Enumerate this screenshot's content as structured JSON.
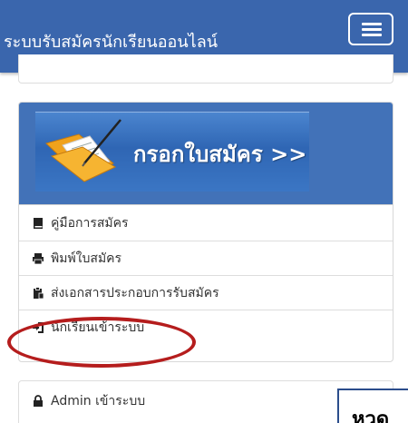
{
  "navbar": {
    "title": "ระบบรับสมัครนักเรียนออนไลน์"
  },
  "banner": {
    "text": "กรอกใบสมัคร >>"
  },
  "menu": {
    "items": [
      {
        "label": "คู่มือการสมัคร",
        "icon": "book-icon"
      },
      {
        "label": "พิมพ์ใบสมัคร",
        "icon": "print-icon"
      },
      {
        "label": "ส่งเอกสารประกอบการรับสมัคร",
        "icon": "clipboard-icon"
      },
      {
        "label": "นักเรียนเข้าระบบ",
        "icon": "sign-in-icon"
      }
    ]
  },
  "admin": {
    "label": "Admin เข้าระบบ",
    "icon": "lock-icon"
  },
  "overlay": {
    "text": "หวด"
  },
  "colors": {
    "navbar": "#3a66ad",
    "panel_head": "#4272b8",
    "highlight": "#b51d1d"
  }
}
